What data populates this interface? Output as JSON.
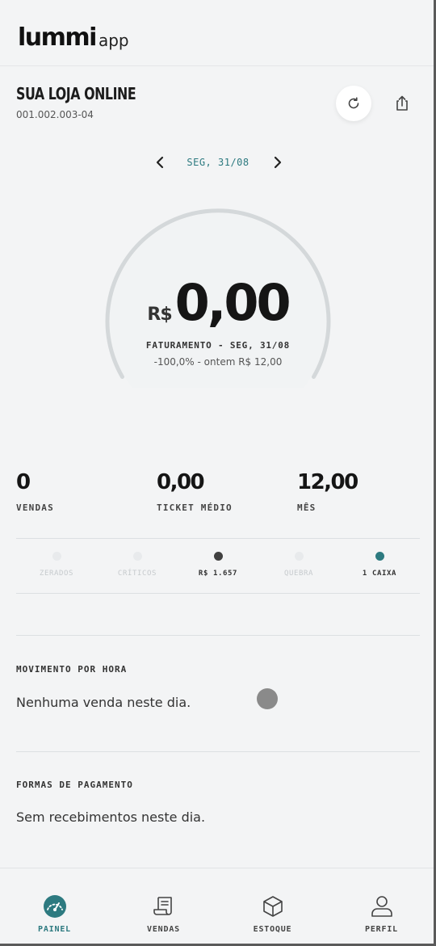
{
  "app": {
    "brand": "lummi",
    "suffix": "app"
  },
  "store": {
    "name": "SUA LOJA ONLINE",
    "code": "001.002.003-04"
  },
  "date_nav": {
    "label": "SEG, 31/08"
  },
  "gauge": {
    "currency": "R$",
    "amount": "0,00",
    "caption": "FATURAMENTO - SEG, 31/08",
    "compare": "-100,0% - ontem R$ 12,00",
    "fill_fraction": 0,
    "track_color": "#d4d8da"
  },
  "stats": [
    {
      "value": "0",
      "label": "VENDAS"
    },
    {
      "value": "0,00",
      "label": "TICKET MÉDIO"
    },
    {
      "value": "12,00",
      "label": "MÊS"
    }
  ],
  "indicators": [
    {
      "label": "ZERADOS",
      "active": false,
      "color": "#e8eaec"
    },
    {
      "label": "CRÍTICOS",
      "active": false,
      "color": "#e8eaec"
    },
    {
      "label": "R$ 1.657",
      "active": true,
      "color": "#404040"
    },
    {
      "label": "QUEBRA",
      "active": false,
      "color": "#e8eaec"
    },
    {
      "label": "1 CAIXA",
      "active": true,
      "color": "#2d7a80"
    }
  ],
  "sections": {
    "hourly": {
      "title": "MOVIMENTO POR HORA",
      "empty_text": "Nenhuma venda neste dia."
    },
    "payments": {
      "title": "FORMAS DE PAGAMENTO",
      "empty_text": "Sem recebimentos neste dia."
    }
  },
  "bottom_nav": [
    {
      "label": "PAINEL",
      "icon": "dashboard-gauge-icon",
      "active": true
    },
    {
      "label": "VENDAS",
      "icon": "receipt-icon",
      "active": false
    },
    {
      "label": "ESTOQUE",
      "icon": "box-icon",
      "active": false
    },
    {
      "label": "PERFIL",
      "icon": "user-icon",
      "active": false
    }
  ],
  "colors": {
    "accent": "#2d7a80",
    "background": "#f3f4f5",
    "text": "#151515"
  }
}
